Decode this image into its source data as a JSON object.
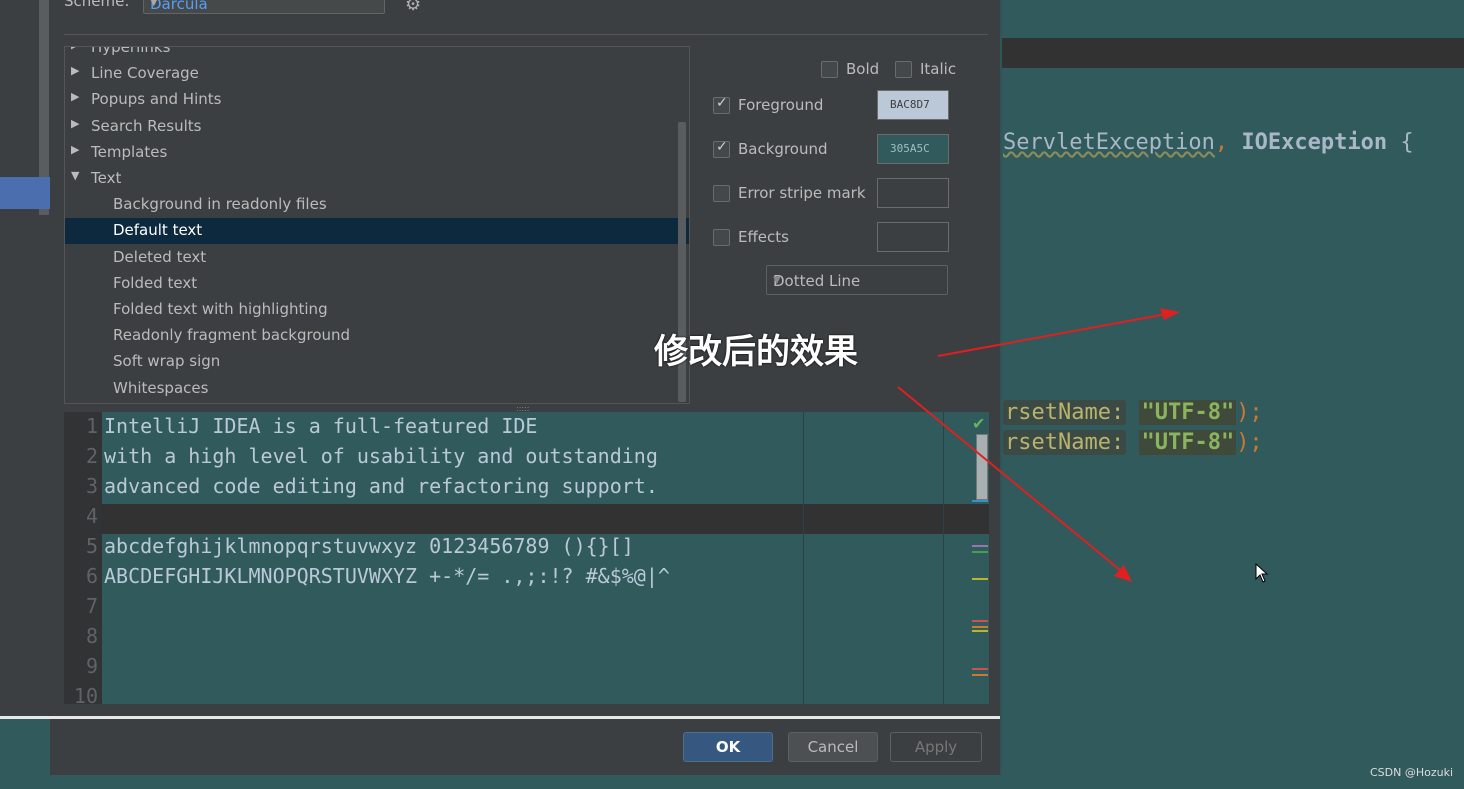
{
  "scheme": {
    "label": "Scheme:",
    "value": "Darcula"
  },
  "tree": {
    "items": [
      {
        "label": "Hyperlinks",
        "expandable": true,
        "level": 0
      },
      {
        "label": "Line Coverage",
        "expandable": true,
        "level": 0
      },
      {
        "label": "Popups and Hints",
        "expandable": true,
        "level": 0
      },
      {
        "label": "Search Results",
        "expandable": true,
        "level": 0
      },
      {
        "label": "Templates",
        "expandable": true,
        "level": 0
      },
      {
        "label": "Text",
        "expandable": true,
        "expanded": true,
        "level": 0
      },
      {
        "label": "Background in readonly files",
        "level": 1
      },
      {
        "label": "Default text",
        "level": 1,
        "selected": true
      },
      {
        "label": "Deleted text",
        "level": 1
      },
      {
        "label": "Folded text",
        "level": 1
      },
      {
        "label": "Folded text with highlighting",
        "level": 1
      },
      {
        "label": "Readonly fragment background",
        "level": 1
      },
      {
        "label": "Soft wrap sign",
        "level": 1
      },
      {
        "label": "Whitespaces",
        "level": 1
      }
    ]
  },
  "options": {
    "bold": {
      "label": "Bold",
      "checked": false
    },
    "italic": {
      "label": "Italic",
      "checked": false
    },
    "foreground": {
      "label": "Foreground",
      "checked": true,
      "color_label": "BAC8D7",
      "color": "#bac8d7"
    },
    "background": {
      "label": "Background",
      "checked": true,
      "color_label": "305A5C",
      "color": "#305a5c"
    },
    "error_stripe": {
      "label": "Error stripe mark",
      "checked": false
    },
    "effects": {
      "label": "Effects",
      "checked": false
    },
    "effect_type": "Dotted Line"
  },
  "preview": {
    "lines": [
      {
        "num": "1",
        "text": "IntelliJ IDEA is a full-featured IDE"
      },
      {
        "num": "2",
        "text": "with a high level of usability and outstanding"
      },
      {
        "num": "3",
        "text": "advanced code editing and refactoring support."
      },
      {
        "num": "4",
        "text": ""
      },
      {
        "num": "5",
        "text": "abcdefghijklmnopqrstuvwxyz 0123456789 (){}[]"
      },
      {
        "num": "6",
        "text": "ABCDEFGHIJKLMNOPQRSTUVWXYZ +-*/= .,;:!? #&$%@|^"
      },
      {
        "num": "7",
        "text": ""
      },
      {
        "num": "8",
        "text": ""
      },
      {
        "num": "9",
        "text": ""
      },
      {
        "num": "10",
        "text": ""
      }
    ]
  },
  "buttons": {
    "ok": "OK",
    "cancel": "Cancel",
    "apply": "Apply"
  },
  "editor": {
    "line1_type": "ServletException",
    "line1_comma": ",",
    "line1_type2": "IOException",
    "line1_brace": "{",
    "hint": "rsetName:",
    "str": "\"UTF-8\"",
    "tail": ");"
  },
  "annotation": "修改后的效果",
  "watermark": "CSDN @Hozuki"
}
